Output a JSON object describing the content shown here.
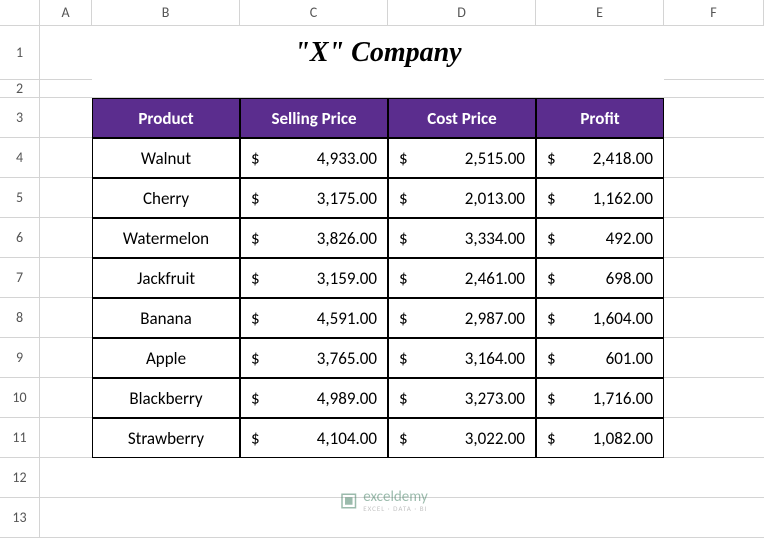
{
  "columns": [
    "A",
    "B",
    "C",
    "D",
    "E",
    "F"
  ],
  "rows": [
    "1",
    "2",
    "3",
    "4",
    "5",
    "6",
    "7",
    "8",
    "9",
    "10",
    "11",
    "12",
    "13"
  ],
  "title": "\"X\" Company",
  "headers": {
    "product": "Product",
    "selling_price": "Selling Price",
    "cost_price": "Cost Price",
    "profit": "Profit"
  },
  "data": [
    {
      "product": "Walnut",
      "selling": "4,933.00",
      "cost": "2,515.00",
      "profit": "2,418.00"
    },
    {
      "product": "Cherry",
      "selling": "3,175.00",
      "cost": "2,013.00",
      "profit": "1,162.00"
    },
    {
      "product": "Watermelon",
      "selling": "3,826.00",
      "cost": "3,334.00",
      "profit": "492.00"
    },
    {
      "product": "Jackfruit",
      "selling": "3,159.00",
      "cost": "2,461.00",
      "profit": "698.00"
    },
    {
      "product": "Banana",
      "selling": "4,591.00",
      "cost": "2,987.00",
      "profit": "1,604.00"
    },
    {
      "product": "Apple",
      "selling": "3,765.00",
      "cost": "3,164.00",
      "profit": "601.00"
    },
    {
      "product": "Blackberry",
      "selling": "4,989.00",
      "cost": "3,273.00",
      "profit": "1,716.00"
    },
    {
      "product": "Strawberry",
      "selling": "4,104.00",
      "cost": "3,022.00",
      "profit": "1,082.00"
    }
  ],
  "currency": "$",
  "watermark": {
    "main": "exceldemy",
    "sub": "EXCEL · DATA · BI"
  }
}
